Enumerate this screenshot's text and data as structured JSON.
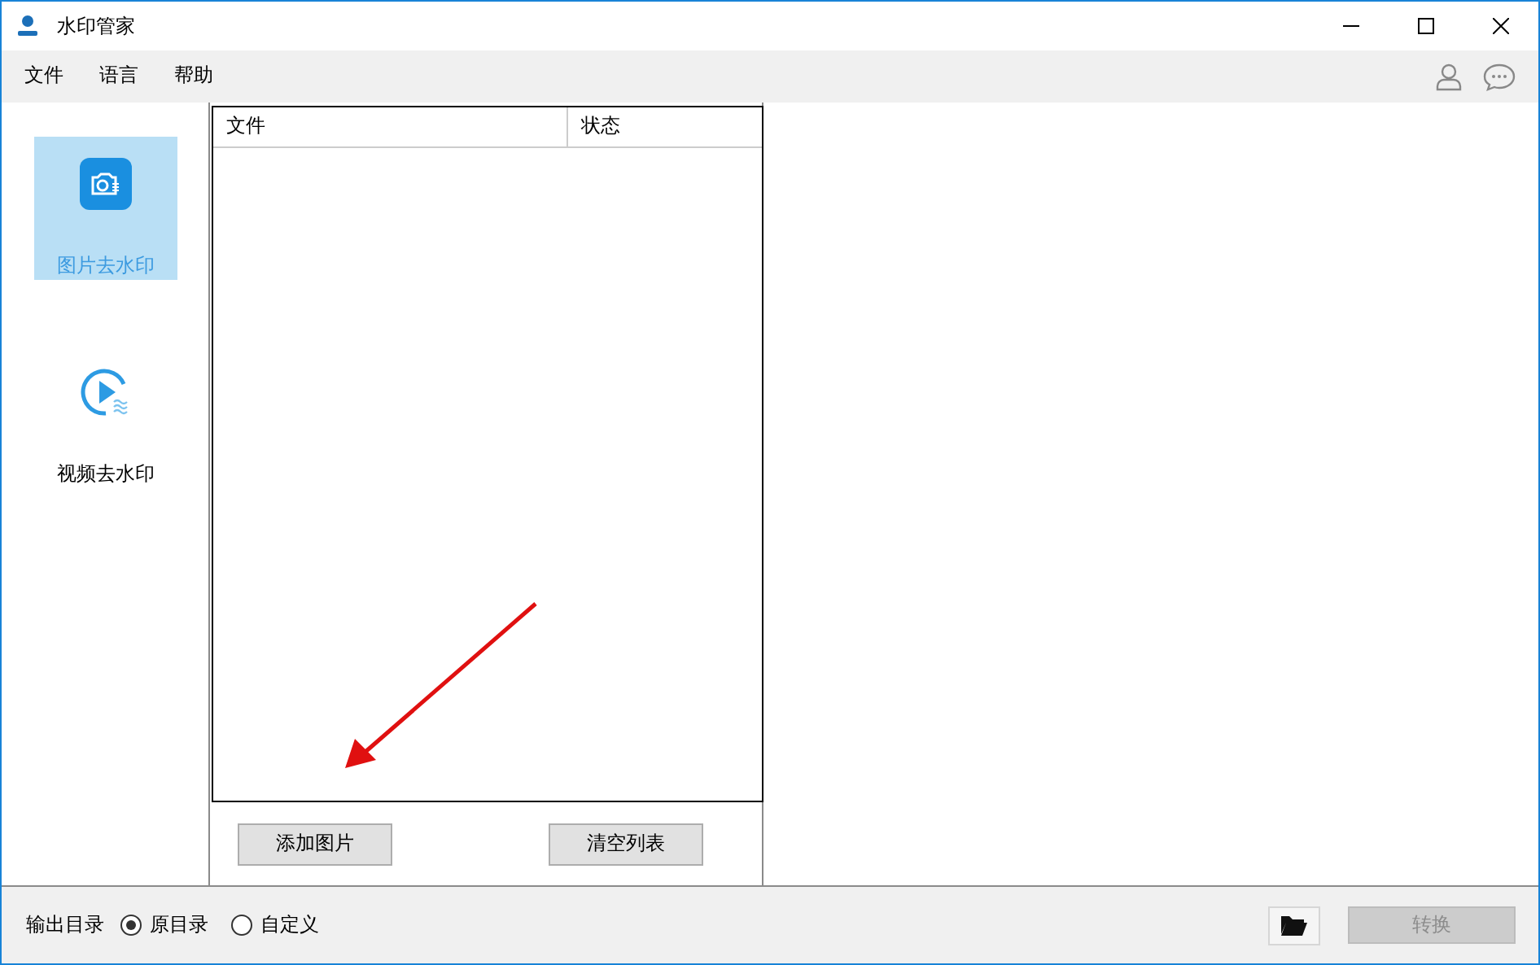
{
  "window": {
    "title": "水印管家"
  },
  "menu": [
    "文件",
    "语言",
    "帮助"
  ],
  "sidebar": {
    "items": [
      {
        "label": "图片去水印",
        "kind": "image",
        "selected": true
      },
      {
        "label": "视频去水印",
        "kind": "video",
        "selected": false
      }
    ]
  },
  "file_table": {
    "columns": [
      "文件",
      "状态"
    ]
  },
  "buttons": [
    "添加图片",
    "清空列表"
  ],
  "output": {
    "label": "输出目录",
    "options": [
      {
        "label": "原目录",
        "selected": true
      },
      {
        "label": "自定义",
        "selected": false
      }
    ]
  },
  "convert_button": {
    "label": "转换",
    "disabled": true
  }
}
